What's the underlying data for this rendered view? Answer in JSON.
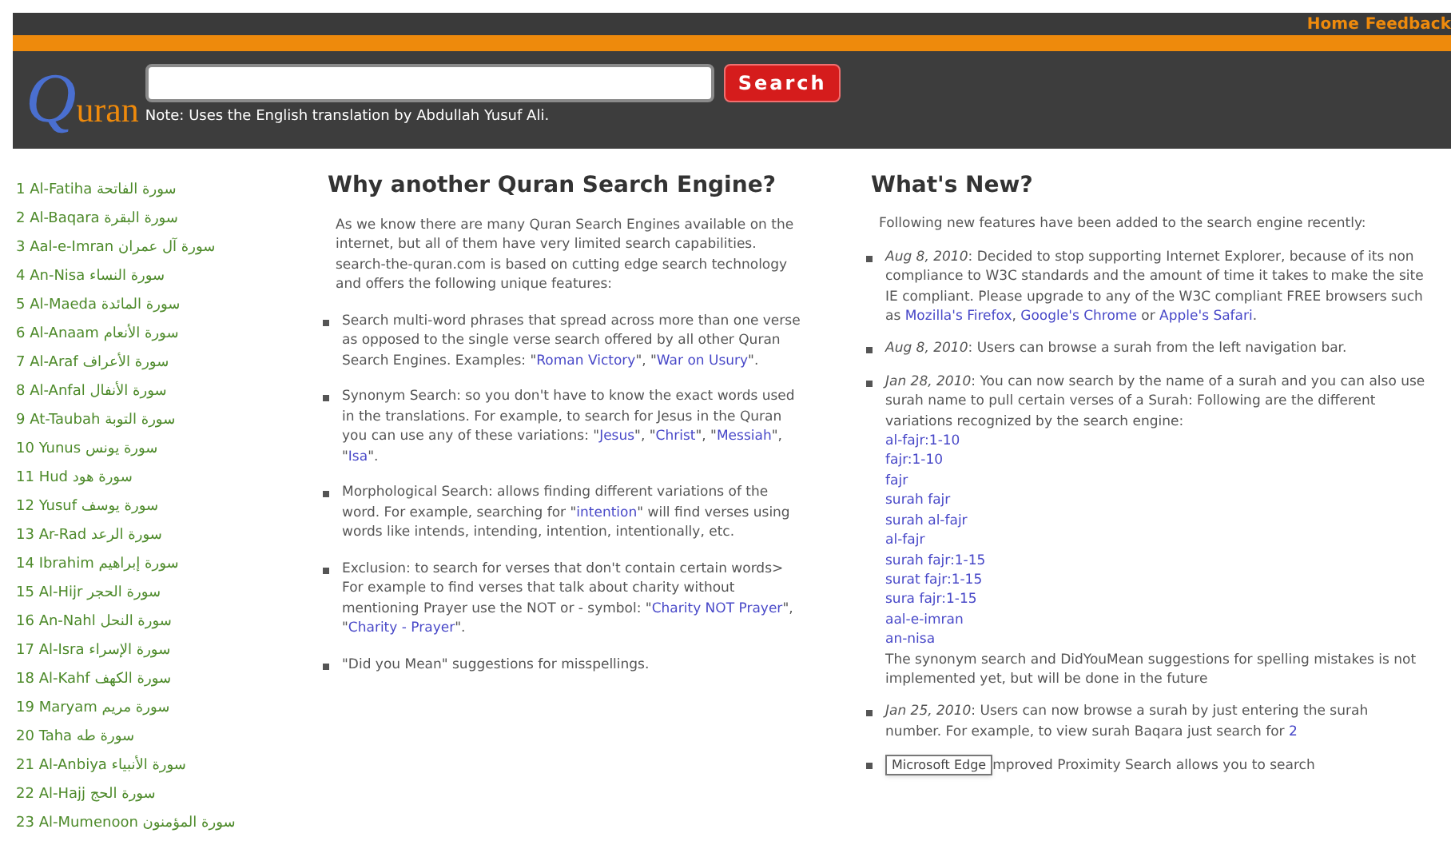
{
  "top_nav": [
    "Home",
    "Feedback"
  ],
  "header": {
    "logo": "Quran",
    "search_button": "Search",
    "note": "Note: Uses the English translation by Abdullah Yusuf Ali."
  },
  "surahs": [
    {
      "number": "1",
      "name": "Al-Fatiha",
      "arabic": "سورة الفاتحة"
    },
    {
      "number": "2",
      "name": "Al-Baqara",
      "arabic": "سورة البقرة"
    },
    {
      "number": "3",
      "name": "Aal-e-Imran",
      "arabic": "سورة آل عمران"
    },
    {
      "number": "4",
      "name": "An-Nisa",
      "arabic": "سورة النساء"
    },
    {
      "number": "5",
      "name": "Al-Maeda",
      "arabic": "سورة المائدة"
    },
    {
      "number": "6",
      "name": "Al-Anaam",
      "arabic": "سورة الأنعام"
    },
    {
      "number": "7",
      "name": "Al-Araf",
      "arabic": "سورة الأعراف"
    },
    {
      "number": "8",
      "name": "Al-Anfal",
      "arabic": "سورة الأنفال"
    },
    {
      "number": "9",
      "name": "At-Taubah",
      "arabic": "سورة التوبة"
    },
    {
      "number": "10",
      "name": "Yunus",
      "arabic": "سورة يونس"
    },
    {
      "number": "11",
      "name": "Hud",
      "arabic": "سورة هود"
    },
    {
      "number": "12",
      "name": "Yusuf",
      "arabic": "سورة يوسف"
    },
    {
      "number": "13",
      "name": "Ar-Rad",
      "arabic": "سورة الرعد"
    },
    {
      "number": "14",
      "name": "Ibrahim",
      "arabic": "سورة إبراهيم"
    },
    {
      "number": "15",
      "name": "Al-Hijr",
      "arabic": "سورة الحجر"
    },
    {
      "number": "16",
      "name": "An-Nahl",
      "arabic": "سورة النحل"
    },
    {
      "number": "17",
      "name": "Al-Isra",
      "arabic": "سورة الإسراء"
    },
    {
      "number": "18",
      "name": "Al-Kahf",
      "arabic": "سورة الكهف"
    },
    {
      "number": "19",
      "name": "Maryam",
      "arabic": "سورة مريم"
    },
    {
      "number": "20",
      "name": "Taha",
      "arabic": "سورة طه"
    },
    {
      "number": "21",
      "name": "Al-Anbiya",
      "arabic": "سورة الأنبياء"
    },
    {
      "number": "22",
      "name": "Al-Hajj",
      "arabic": "سورة الحج"
    },
    {
      "number": "23",
      "name": "Al-Mumenoon",
      "arabic": "سورة المؤمنون"
    }
  ],
  "why": {
    "heading": "Why another Quran Search Engine?",
    "intro": "As we know there are many Quran Search Engines available on the internet, but all of them have very limited search capabilities. search-the-quran.com is based on cutting edge search technology and offers the following unique features:",
    "items": [
      {
        "parts": [
          {
            "kind": "text",
            "text": "Search multi-word phrases that spread across more than one verse as opposed to the single verse search offered by all other Quran Search Engines. Examples: \""
          },
          {
            "kind": "link",
            "text": "Roman Victory"
          },
          {
            "kind": "text",
            "text": "\", \""
          },
          {
            "kind": "link",
            "text": "War on Usury"
          },
          {
            "kind": "text",
            "text": "\"."
          }
        ]
      },
      {
        "parts": [
          {
            "kind": "text",
            "text": "Synonym Search: so you don't have to know the exact words used in the translations. For example, to search for Jesus in the Quran you can use any of these variations: \""
          },
          {
            "kind": "link",
            "text": "Jesus"
          },
          {
            "kind": "text",
            "text": "\", \""
          },
          {
            "kind": "link",
            "text": "Christ"
          },
          {
            "kind": "text",
            "text": "\", \""
          },
          {
            "kind": "link",
            "text": "Messiah"
          },
          {
            "kind": "text",
            "text": "\", \""
          },
          {
            "kind": "link",
            "text": "Isa"
          },
          {
            "kind": "text",
            "text": "\"."
          }
        ]
      },
      {
        "parts": [
          {
            "kind": "text",
            "text": "Morphological Search: allows finding different variations of the word. For example, searching for \""
          },
          {
            "kind": "link",
            "text": "intention"
          },
          {
            "kind": "text",
            "text": "\" will find verses using words like intends, intending, intention, intentionally, etc."
          }
        ]
      },
      {
        "parts": [
          {
            "kind": "text",
            "text": "Exclusion: to search for verses that don't contain certain words> For example to find verses that talk about charity without mentioning Prayer use the NOT or - symbol: \""
          },
          {
            "kind": "link",
            "text": "Charity NOT Prayer"
          },
          {
            "kind": "text",
            "text": "\", \""
          },
          {
            "kind": "link",
            "text": "Charity - Prayer"
          },
          {
            "kind": "text",
            "text": "\"."
          }
        ]
      },
      {
        "parts": [
          {
            "kind": "text",
            "text": "\"Did you Mean\" suggestions for misspellings."
          }
        ]
      }
    ]
  },
  "whats_new": {
    "heading": "What's New?",
    "intro": "Following new features have been added to the search engine recently:",
    "items": [
      {
        "parts": [
          {
            "kind": "date",
            "text": "Aug 8, 2010"
          },
          {
            "kind": "text",
            "text": ": Decided to stop supporting Internet Explorer, because of its non compliance to W3C standards and the amount of time it takes to make the site IE compliant. Please upgrade to any of the W3C compliant FREE browsers such as "
          },
          {
            "kind": "link",
            "text": "Mozilla's Firefox"
          },
          {
            "kind": "text",
            "text": ", "
          },
          {
            "kind": "link",
            "text": "Google's Chrome"
          },
          {
            "kind": "text",
            "text": " or "
          },
          {
            "kind": "link",
            "text": "Apple's Safari"
          },
          {
            "kind": "text",
            "text": "."
          }
        ]
      },
      {
        "parts": [
          {
            "kind": "date",
            "text": "Aug 8, 2010"
          },
          {
            "kind": "text",
            "text": ": Users can browse a surah from the left navigation bar."
          }
        ]
      },
      {
        "parts": [
          {
            "kind": "date",
            "text": "Jan 28, 2010"
          },
          {
            "kind": "text",
            "text": ": You can now search by the name of a surah and you can also use surah name to pull certain verses of a Surah: Following are the different variations recognized by the search engine:"
          },
          {
            "kind": "line_link",
            "text": "al-fajr:1-10"
          },
          {
            "kind": "line_link",
            "text": "fajr:1-10"
          },
          {
            "kind": "line_link",
            "text": "fajr"
          },
          {
            "kind": "line_link",
            "text": "surah fajr"
          },
          {
            "kind": "line_link",
            "text": "surah al-fajr"
          },
          {
            "kind": "line_link",
            "text": "al-fajr"
          },
          {
            "kind": "line_link",
            "text": "surah fajr:1-15"
          },
          {
            "kind": "line_link",
            "text": "surat fajr:1-15"
          },
          {
            "kind": "line_link",
            "text": "sura fajr:1-15"
          },
          {
            "kind": "line_link",
            "text": "aal-e-imran"
          },
          {
            "kind": "line_link",
            "text": "an-nisa"
          },
          {
            "kind": "line_text",
            "text": "The synonym search and DidYouMean suggestions for spelling mistakes is not implemented yet, but will be done in the future"
          }
        ]
      },
      {
        "parts": [
          {
            "kind": "date",
            "text": "Jan 25, 2010"
          },
          {
            "kind": "text",
            "text": ": Users can now browse a surah by just entering the surah number. For example, to view surah Baqara just search for "
          },
          {
            "kind": "link",
            "text": "2"
          }
        ]
      },
      {
        "parts": [
          {
            "kind": "tooltip",
            "text": "Microsoft Edge"
          },
          {
            "kind": "text",
            "text": "mproved Proximity Search allows you to search"
          }
        ]
      }
    ]
  }
}
